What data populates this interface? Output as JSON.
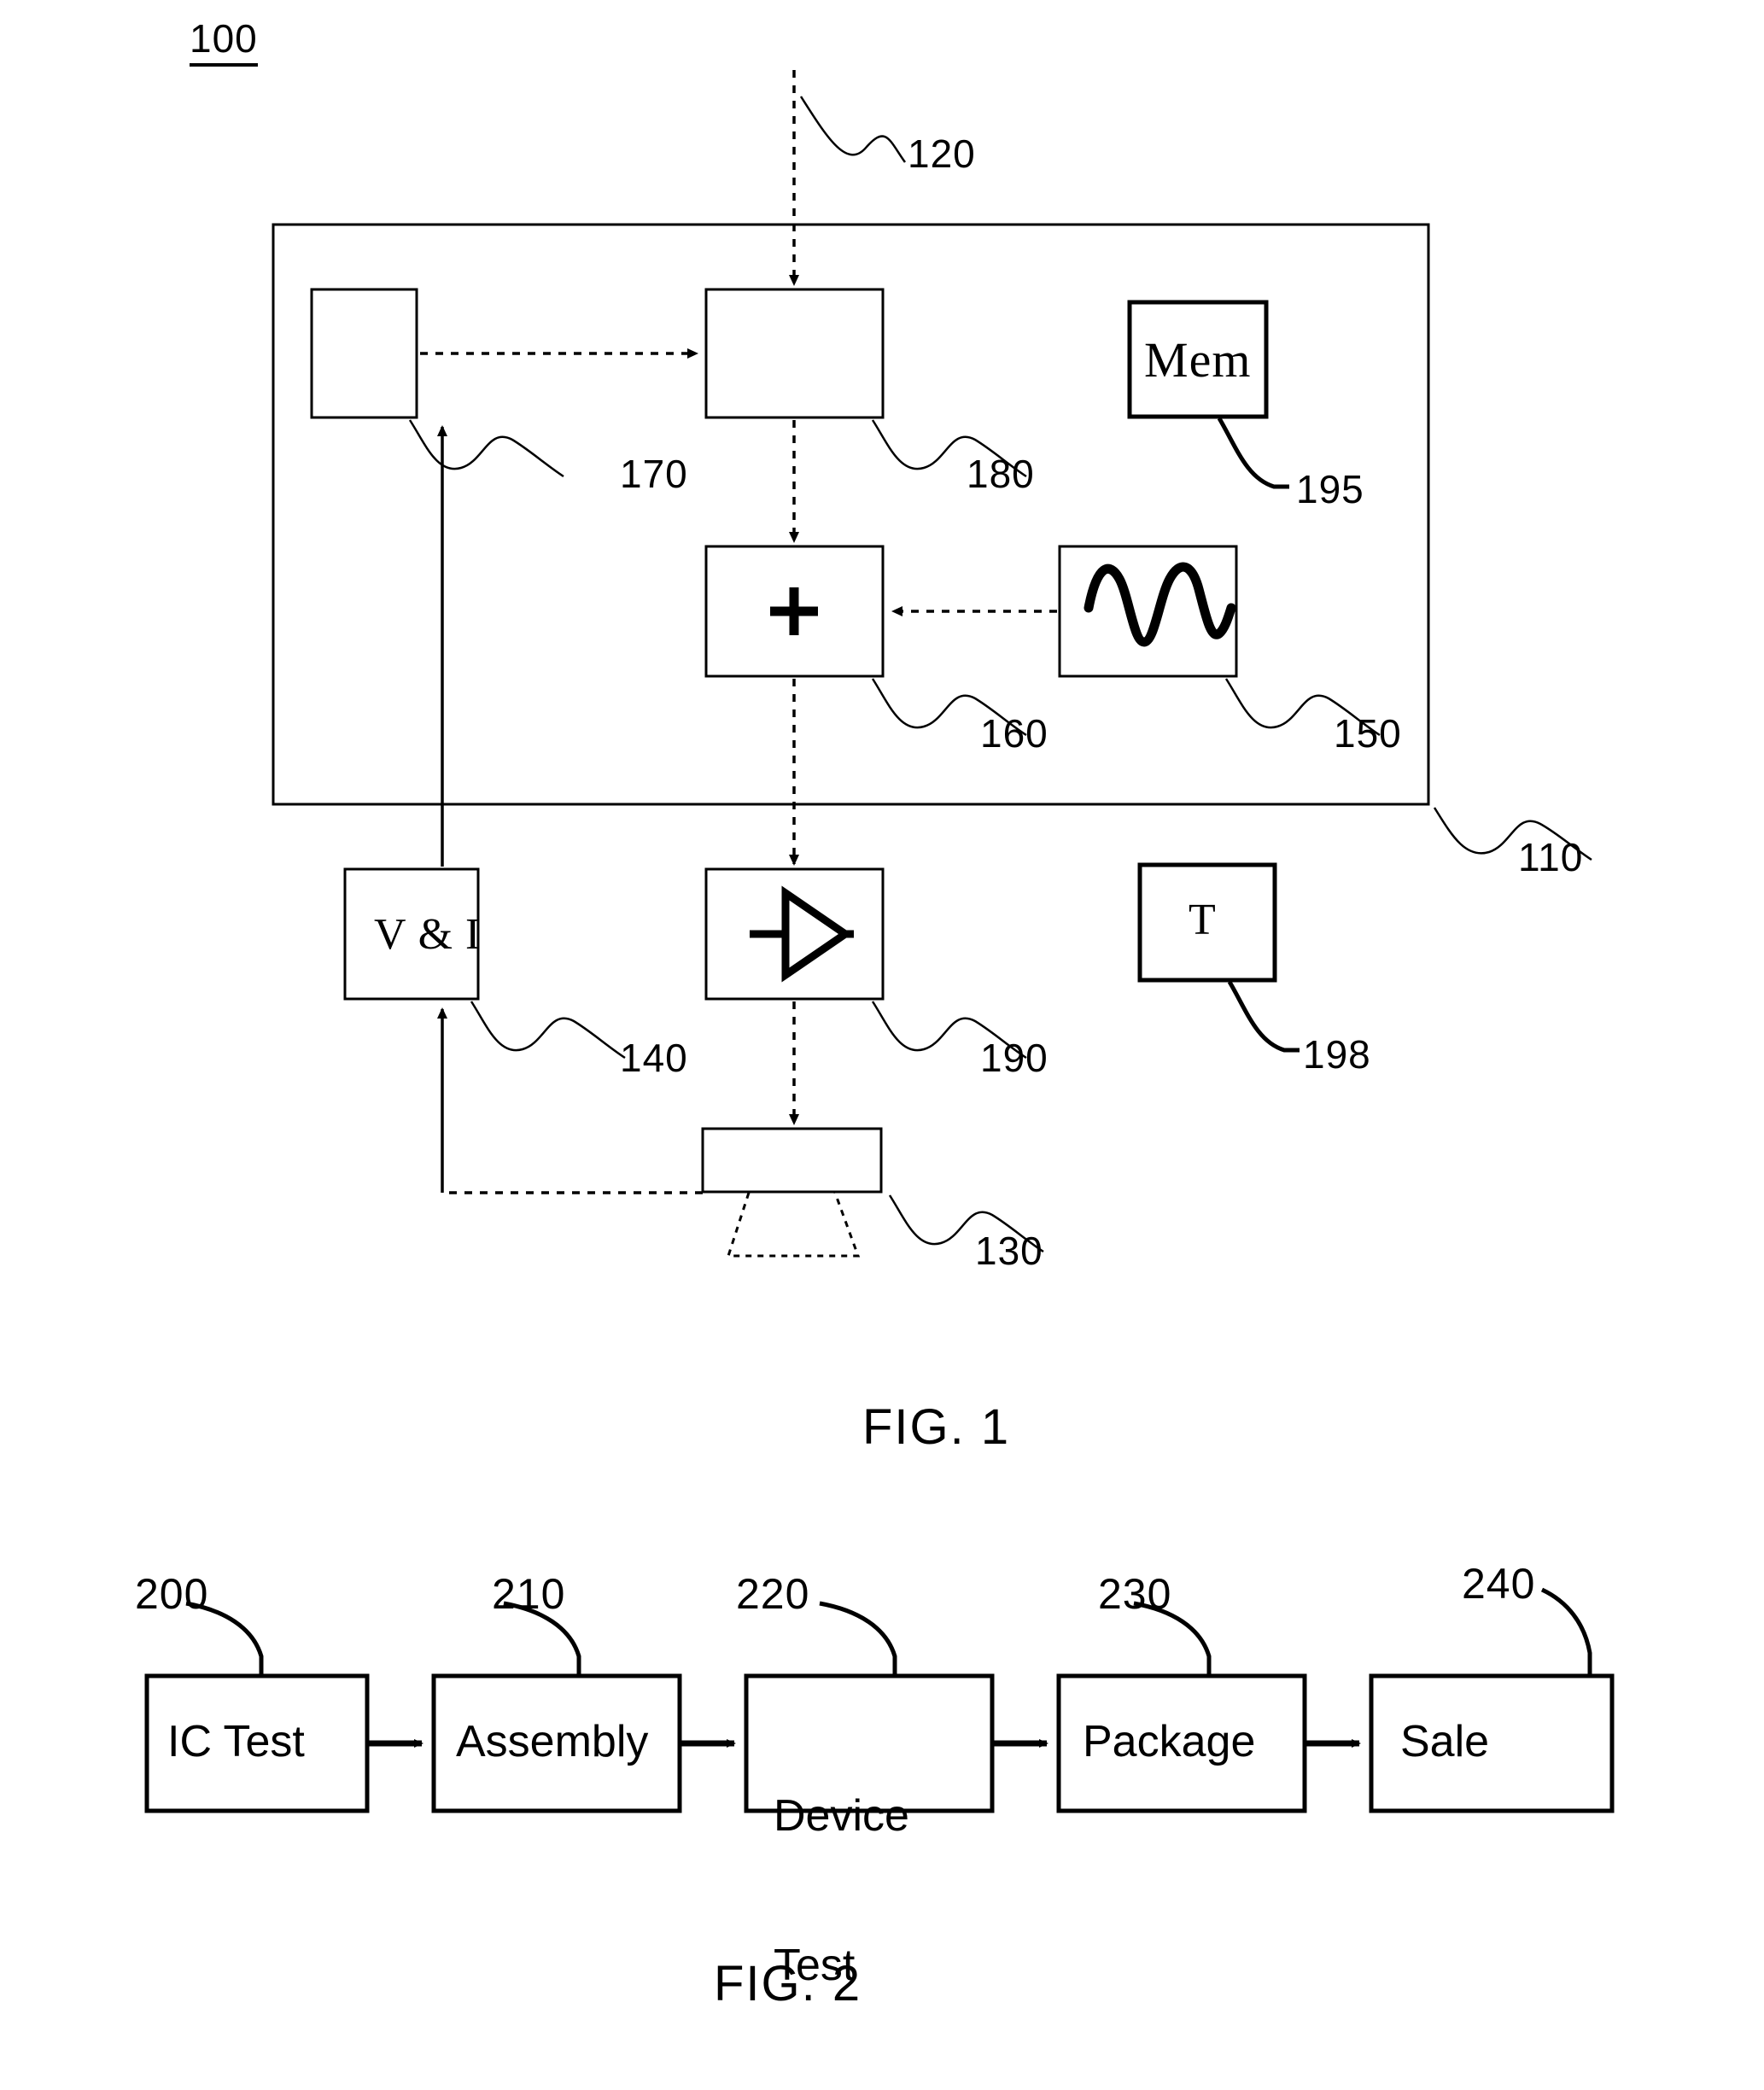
{
  "document": {
    "type": "patent-drawing-sheet",
    "figures": [
      "FIG. 1",
      "FIG. 2"
    ]
  },
  "figure1": {
    "caption": "FIG. 1",
    "system_numeral": "100",
    "numerals": {
      "input_signal": "120",
      "tester_enclosure": "110",
      "controller": "170",
      "signal_source": "180",
      "adder": "160",
      "noise_generator": "150",
      "memory": "195",
      "measurement": "140",
      "amplifier": "190",
      "temperature": "198",
      "dut": "130"
    },
    "blocks": [
      {
        "id": "170",
        "label": "",
        "numeral": "170"
      },
      {
        "id": "180",
        "label": "",
        "numeral": "180"
      },
      {
        "id": "160",
        "label": "+",
        "numeral": "160"
      },
      {
        "id": "150",
        "label": "sine-wave-icon",
        "numeral": "150"
      },
      {
        "id": "195",
        "label": "Mem",
        "numeral": "195"
      },
      {
        "id": "140",
        "label": "V & I",
        "numeral": "140"
      },
      {
        "id": "190",
        "label": "amplifier-icon",
        "numeral": "190"
      },
      {
        "id": "198",
        "label": "T",
        "numeral": "198"
      },
      {
        "id": "130",
        "label": "",
        "numeral": "130"
      }
    ],
    "adder_symbol": "+",
    "memory_label": "Mem",
    "measurement_label": "V & I",
    "temperature_label": "T"
  },
  "figure2": {
    "caption": "FIG. 2",
    "steps": [
      {
        "label": "IC Test",
        "numeral": "200"
      },
      {
        "label": "Assembly",
        "numeral": "210"
      },
      {
        "label": "Device\nTest",
        "numeral": "220",
        "line1": "Device",
        "line2": "Test"
      },
      {
        "label": "Package",
        "numeral": "230"
      },
      {
        "label": "Sale",
        "numeral": "240"
      }
    ]
  },
  "colors": {
    "ink": "#000000",
    "paper": "#ffffff"
  }
}
